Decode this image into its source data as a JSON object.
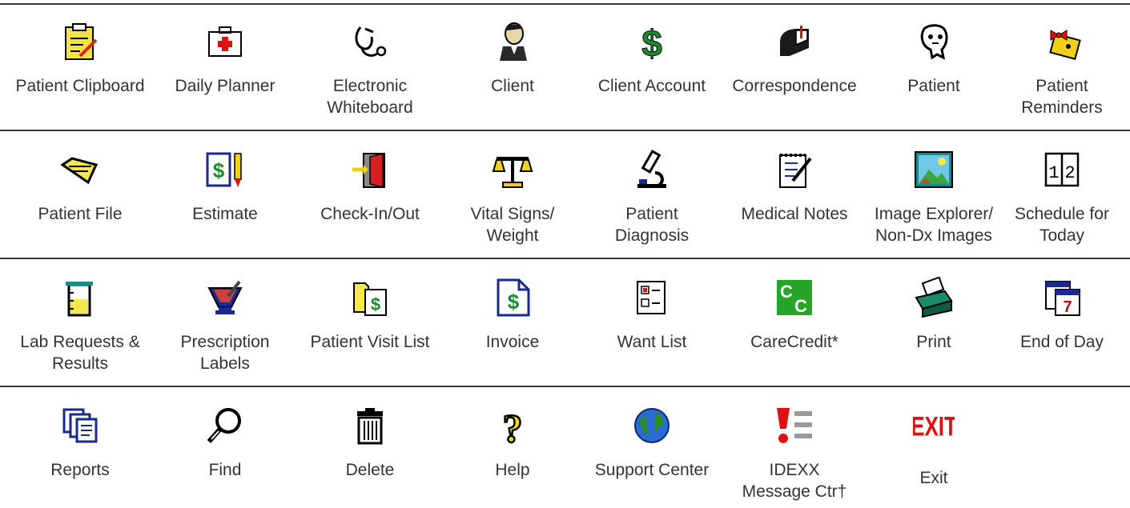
{
  "rows": [
    [
      {
        "label": "Patient Clipboard",
        "icon": "clipboard-icon"
      },
      {
        "label": "Daily Planner",
        "icon": "medical-kit-icon"
      },
      {
        "label": "Electronic\nWhiteboard",
        "icon": "stethoscope-icon"
      },
      {
        "label": "Client",
        "icon": "person-icon"
      },
      {
        "label": "Client Account",
        "icon": "dollar-icon"
      },
      {
        "label": "Correspondence",
        "icon": "mailbox-icon"
      },
      {
        "label": "Patient",
        "icon": "dog-icon"
      },
      {
        "label": "Patient\nReminders",
        "icon": "reminder-bow-icon"
      }
    ],
    [
      {
        "label": "Patient File",
        "icon": "folder-icon"
      },
      {
        "label": "Estimate",
        "icon": "estimate-icon"
      },
      {
        "label": "Check-In/Out",
        "icon": "door-icon"
      },
      {
        "label": "Vital Signs/\nWeight",
        "icon": "scale-icon"
      },
      {
        "label": "Patient\nDiagnosis",
        "icon": "microscope-icon"
      },
      {
        "label": "Medical Notes",
        "icon": "notepad-icon"
      },
      {
        "label": "Image Explorer/\nNon-Dx Images",
        "icon": "picture-icon"
      },
      {
        "label": "Schedule for\nToday",
        "icon": "calendar-book-icon"
      }
    ],
    [
      {
        "label": "Lab Requests &\nResults",
        "icon": "beaker-icon"
      },
      {
        "label": "Prescription\nLabels",
        "icon": "mortar-pestle-icon"
      },
      {
        "label": "Patient  Visit List",
        "icon": "visit-list-icon"
      },
      {
        "label": "Invoice",
        "icon": "invoice-icon"
      },
      {
        "label": "Want List",
        "icon": "checklist-icon"
      },
      {
        "label": "CareCredit*",
        "icon": "carecredit-icon"
      },
      {
        "label": "Print",
        "icon": "printer-icon"
      },
      {
        "label": "End of Day",
        "icon": "calendar-icon"
      }
    ],
    [
      {
        "label": "Reports",
        "icon": "reports-icon"
      },
      {
        "label": "Find",
        "icon": "magnifier-icon"
      },
      {
        "label": "Delete",
        "icon": "trash-icon"
      },
      {
        "label": "Help",
        "icon": "question-icon"
      },
      {
        "label": "Support Center",
        "icon": "globe-icon"
      },
      {
        "label": "IDEXX\nMessage Ctr†",
        "icon": "message-alert-icon"
      },
      {
        "label": "Exit",
        "icon": "exit-icon"
      }
    ]
  ],
  "colors": {
    "rule": "#3a3a3a",
    "text": "#333333",
    "dollar_green": "#1e8a2e",
    "navy": "#1a2a8a",
    "alert_red": "#e01010"
  }
}
